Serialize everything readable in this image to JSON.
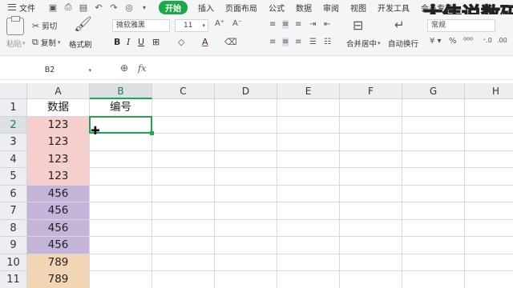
{
  "menu": {
    "file": "文件",
    "tabs": [
      "开始",
      "插入",
      "页面布局",
      "公式",
      "数据",
      "审阅",
      "视图",
      "开发工具",
      "会员专享"
    ],
    "active_tab": "开始"
  },
  "ribbon": {
    "paste": "粘贴",
    "cut": "剪切",
    "copy": "复制",
    "format_painter": "格式刷",
    "font_name": "微软雅黑",
    "font_size": "11",
    "merge_center": "合并居中",
    "wrap_text": "自动换行",
    "number_format": "常规"
  },
  "formula_bar": {
    "name_box": "B2",
    "formula": ""
  },
  "grid": {
    "columns": [
      "A",
      "B",
      "C",
      "D",
      "E",
      "F",
      "G",
      "H"
    ],
    "selected_column": "B",
    "rows": [
      "1",
      "2",
      "3",
      "4",
      "5",
      "6",
      "7",
      "8",
      "9",
      "10",
      "11"
    ],
    "selected_row": "2",
    "column_a": [
      "数据",
      "123",
      "123",
      "123",
      "123",
      "456",
      "456",
      "456",
      "456",
      "789",
      "789"
    ],
    "column_b": [
      "编号",
      "",
      "",
      "",
      "",
      "",
      "",
      "",
      "",
      "",
      ""
    ],
    "fill_colors": {
      "123": "#f6cfcd",
      "456": "#c4b4d9",
      "789": "#f2d6b4"
    },
    "selection_color": "#1fa84a"
  },
  "watermark": "大伟说数码"
}
